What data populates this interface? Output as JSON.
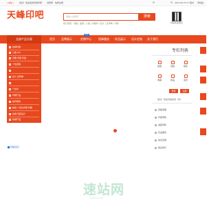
{
  "topbar": {
    "location": "[ 地址 ]",
    "welcome": "您好！欢迎来到天峰印吧",
    "login": "请登录",
    "register": "免费注册",
    "phone": "400-333-3777",
    "links": [
      "官方",
      "手机站"
    ]
  },
  "header": {
    "logo": "天峰印吧",
    "search_placeholder": "请输入关键词",
    "search_button": "搜索",
    "hot_words": "热门搜索：刻章 | 发票 | 公章 | 光敏印 | 名片 | 宣传单 | 印刷",
    "qr_label": "扫码关注我们"
  },
  "nav": {
    "category_title": "全部产品分类",
    "items": [
      "首页",
      "品牌展示",
      "定制中心",
      "找章服务",
      "样品展示",
      "设计定制",
      "关于我们"
    ],
    "badge": "HOT"
  },
  "categories": [
    "热销印章",
    "公章   Ppt",
    "光敏   印章   印油",
    "个性定制",
    "",
    "名片   宣传单",
    "",
    "个性印",
    "印刷产品",
    "快印服务",
    "精选   个性化印刷  印刷",
    "热销   包装设计",
    "热销产品"
  ],
  "right": {
    "title": "专栏列表",
    "tiles": [
      {
        "icon": "document-icon",
        "label": "热销"
      },
      {
        "icon": "star-icon",
        "label": "定制"
      },
      {
        "icon": "phone-icon",
        "label": "联系"
      },
      {
        "icon": "heart-icon",
        "label": "收藏"
      },
      {
        "icon": "box-icon",
        "label": "新品"
      },
      {
        "icon": "user-icon",
        "label": "会员"
      }
    ],
    "btn_login": "登录",
    "btn_register": "注册",
    "prompt": "您好！欢迎光临本店（请）",
    "items": [
      "刻章流程",
      "印章须知",
      "发票须知",
      "售后服务",
      "常见问题",
      "联系我们"
    ]
  },
  "bottom": {
    "hide": "隐藏/显示",
    "watermark": "速站网",
    "watermark_sub": "SUZHAN.NET"
  },
  "colors": {
    "accent": "#e8481e",
    "link": "#2f6fd6",
    "watermark": "#c3e6d3"
  }
}
